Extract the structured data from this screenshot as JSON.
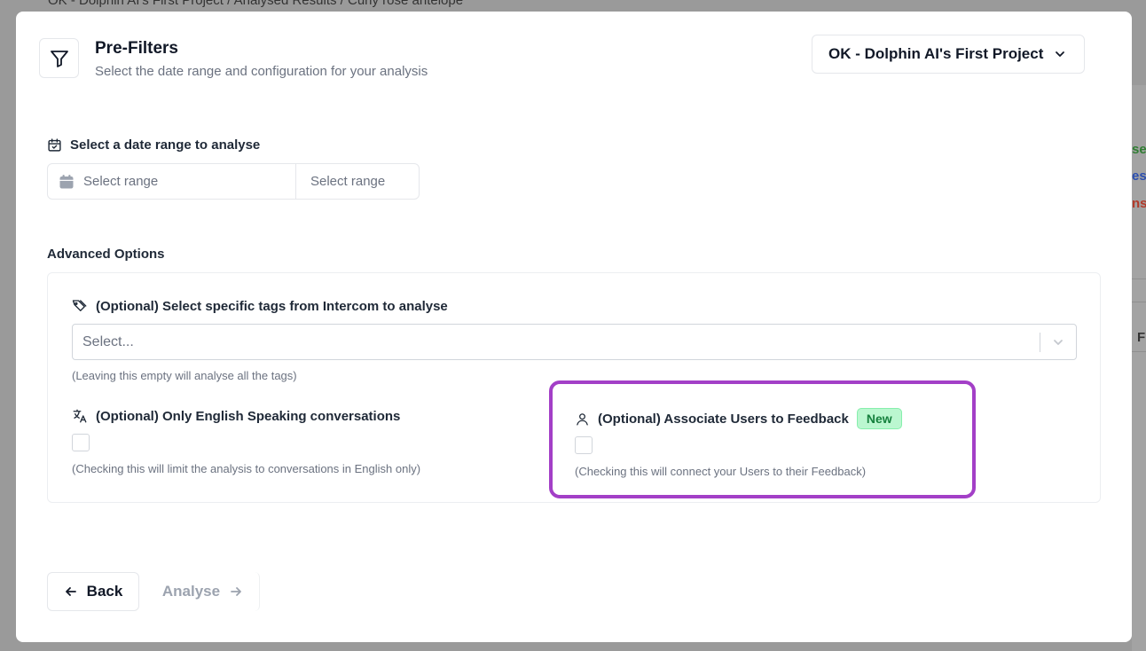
{
  "background": {
    "breadcrumb": "OK - Dolphin AI's First Project / Analysed Results / Curly rose antelope",
    "side_texts": [
      {
        "text": "se",
        "color": "#2f7d32"
      },
      {
        "text": "es",
        "color": "#2c4fb0"
      },
      {
        "text": "nse",
        "color": "#b23a2a"
      },
      {
        "text": "F",
        "color": "#333333"
      }
    ]
  },
  "header": {
    "title": "Pre-Filters",
    "subtitle": "Select the date range and configuration for your analysis",
    "icon": "filter-icon",
    "project_select": "OK - Dolphin AI's First Project"
  },
  "date_range": {
    "label": "Select a date range to analyse",
    "start_placeholder": "Select range",
    "end_placeholder": "Select range"
  },
  "advanced": {
    "title": "Advanced Options",
    "tags": {
      "label": "(Optional) Select specific tags from Intercom to analyse",
      "placeholder": "Select...",
      "hint": "(Leaving this empty will analyse all the tags)"
    },
    "english": {
      "label": "(Optional) Only English Speaking conversations",
      "checked": false,
      "hint": "(Checking this will limit the analysis to conversations in English only)"
    },
    "associate_users": {
      "label": "(Optional) Associate Users to Feedback",
      "badge": "New",
      "checked": false,
      "hint": "(Checking this will connect your Users to their Feedback)"
    }
  },
  "footer": {
    "back_label": "Back",
    "analyse_label": "Analyse"
  },
  "colors": {
    "highlight": "#a33fc7",
    "badge_bg": "#bbf7d0",
    "badge_text": "#15803d"
  }
}
